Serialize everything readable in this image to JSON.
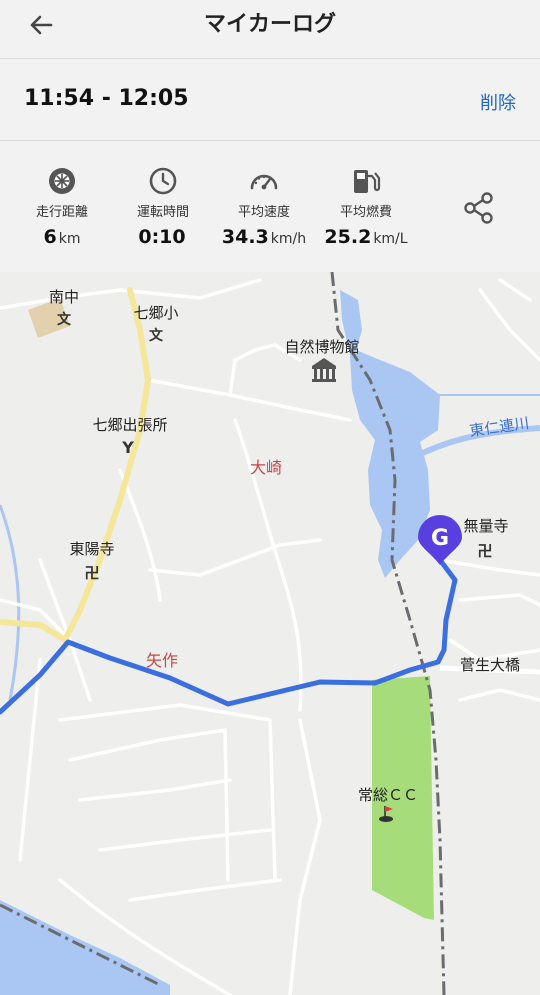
{
  "header": {
    "title": "マイカーログ"
  },
  "trip": {
    "time_range": "11:54 - 12:05",
    "delete_label": "削除"
  },
  "stats": [
    {
      "label": "走行距離",
      "value": "6",
      "unit": "km"
    },
    {
      "label": "運転時間",
      "value": "0:10",
      "unit": ""
    },
    {
      "label": "平均速度",
      "value": "34.3",
      "unit": "km/h"
    },
    {
      "label": "平均燃費",
      "value": "25.2",
      "unit": "km/L"
    }
  ],
  "map": {
    "goal_marker": "G",
    "labels": {
      "nanchu": "南中",
      "shichigo_elem": "七郷小",
      "museum": "自然博物館",
      "river": "東仁連川",
      "branch_office": "七郷出張所",
      "osaki": "大崎",
      "toyoji": "東陽寺",
      "muryoji": "無量寺",
      "yasaku": "矢作",
      "sugou_bridge": "菅生大橋",
      "golf": "常総ＣＣ"
    },
    "colors": {
      "route": "#3b6fe0",
      "water": "#a9c7f2",
      "park": "#a6dd7a",
      "goal": "#5a3fe0"
    }
  }
}
